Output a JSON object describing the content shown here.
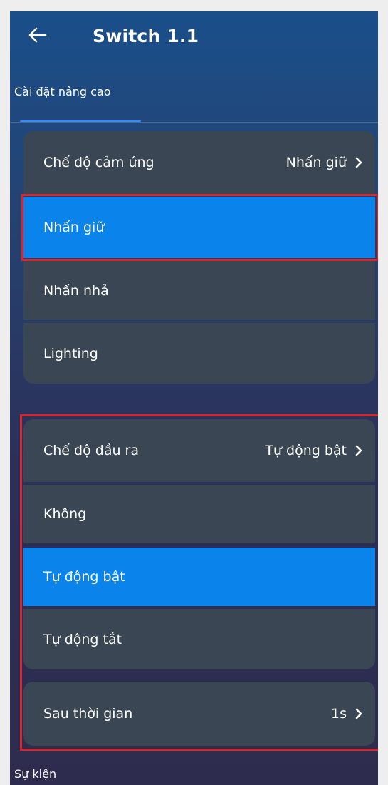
{
  "header": {
    "title": "Switch 1.1"
  },
  "tabs": [
    {
      "label": "Cài đặt nâng cao",
      "active": true
    }
  ],
  "touch_mode": {
    "label": "Chế độ cảm ứng",
    "value": "Nhấn giữ",
    "options": [
      {
        "label": "Nhấn giữ",
        "selected": true
      },
      {
        "label": "Nhấn nhả",
        "selected": false
      },
      {
        "label": "Lighting",
        "selected": false
      }
    ]
  },
  "output_mode": {
    "label": "Chế độ đầu ra",
    "value": "Tự động bật",
    "options": [
      {
        "label": "Không",
        "selected": false
      },
      {
        "label": "Tự động bật",
        "selected": true
      },
      {
        "label": "Tự động tắt",
        "selected": false
      }
    ]
  },
  "delay": {
    "label": "Sau thời gian",
    "value": "1s"
  },
  "section_events": {
    "label": "Sự kiện"
  },
  "colors": {
    "accent": "#0a84ea",
    "row_bg": "#3a4653",
    "highlight_border": "#d9252a"
  }
}
